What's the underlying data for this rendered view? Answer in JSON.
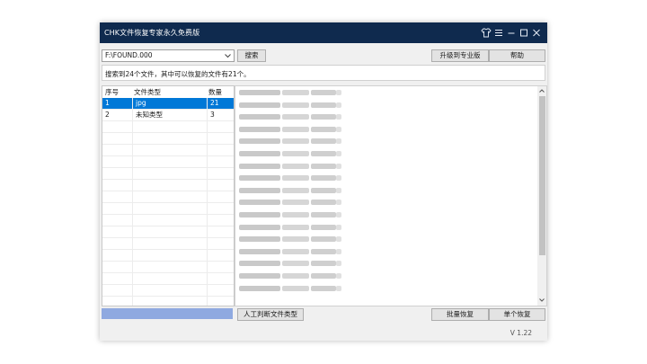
{
  "window": {
    "title": "CHK文件恢复专家永久免费版"
  },
  "titlebar_icons": [
    "shirt-icon",
    "menu-icon",
    "minimize-icon",
    "maximize-icon",
    "close-icon"
  ],
  "toolbar": {
    "drive_value": "F:\\FOUND.000",
    "search_label": "搜索",
    "upgrade_label": "升级到专业版",
    "help_label": "帮助"
  },
  "status": {
    "text": "搜索到24个文件，其中可以恢复的文件有21个。"
  },
  "table": {
    "headers": [
      "序号",
      "文件类型",
      "数量"
    ],
    "rows": [
      {
        "index": "1",
        "type": "jpg",
        "count": "21",
        "selected": true
      },
      {
        "index": "2",
        "type": "未知类型",
        "count": "3",
        "selected": false
      }
    ]
  },
  "progress": {
    "value": 1.0,
    "color": "#8fa9e0"
  },
  "bottom": {
    "manual_label": "人工判断文件类型",
    "batch_label": "批量恢复",
    "single_label": "单个恢复"
  },
  "footer": {
    "version": "V 1.22"
  },
  "colors": {
    "titlebar": "#0f2a4e",
    "selection": "#0078d7"
  }
}
